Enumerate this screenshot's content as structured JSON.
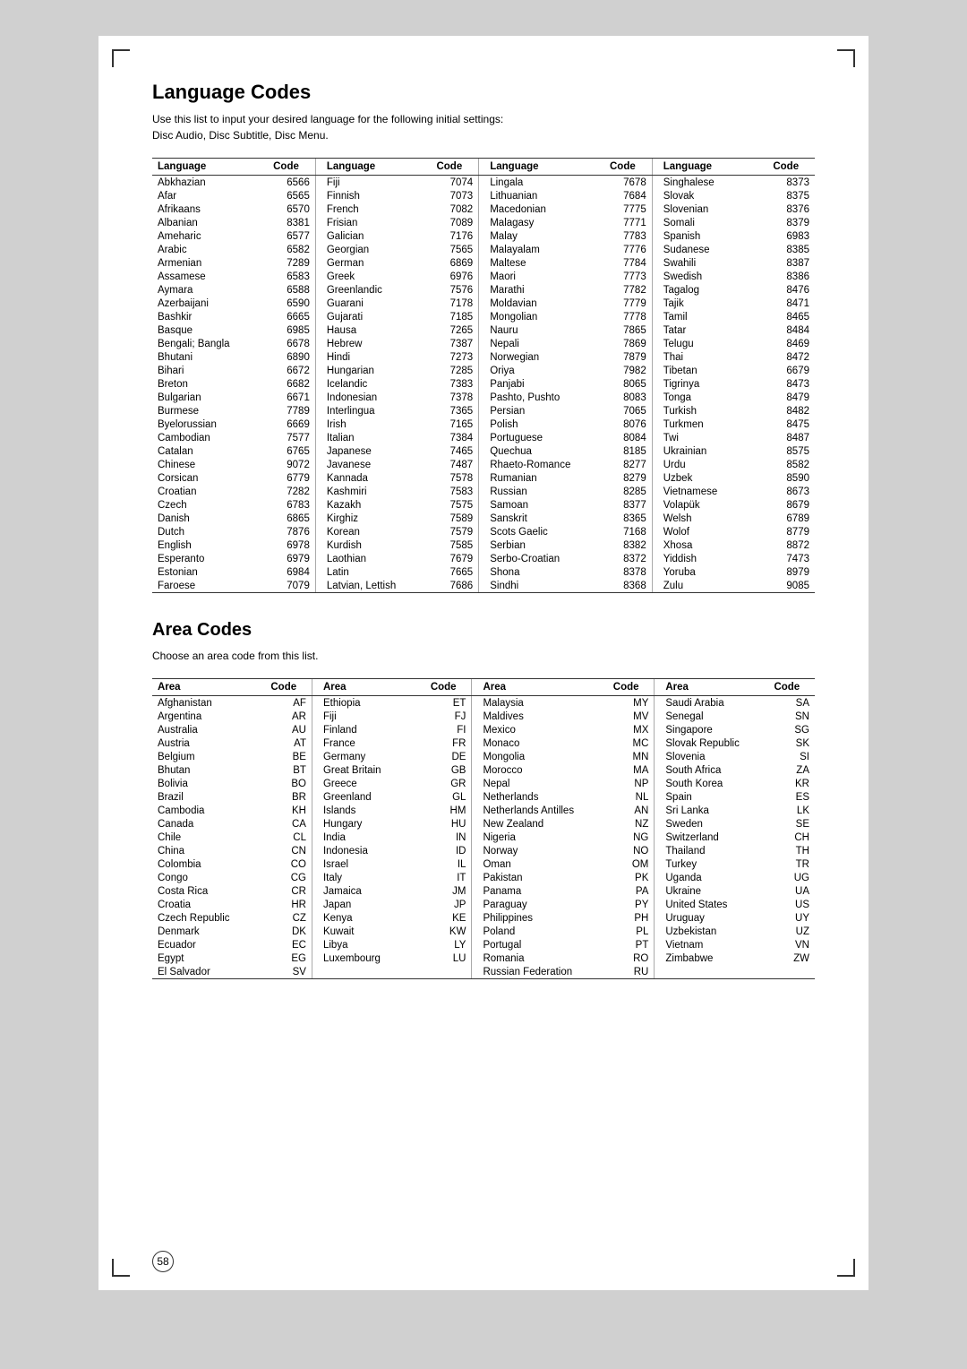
{
  "page": {
    "title": "Language Codes",
    "description": "Use this list to input your desired language for the following initial settings:\nDisc Audio, Disc Subtitle, Disc Menu.",
    "area_title": "Area Codes",
    "area_description": "Choose an area code from this list.",
    "page_number": "58"
  },
  "language_table": {
    "headers": [
      "Language",
      "Code"
    ],
    "columns": [
      [
        [
          "Abkhazian",
          "6566"
        ],
        [
          "Afar",
          "6565"
        ],
        [
          "Afrikaans",
          "6570"
        ],
        [
          "Albanian",
          "8381"
        ],
        [
          "Ameharic",
          "6577"
        ],
        [
          "Arabic",
          "6582"
        ],
        [
          "Armenian",
          "7289"
        ],
        [
          "Assamese",
          "6583"
        ],
        [
          "Aymara",
          "6588"
        ],
        [
          "Azerbaijani",
          "6590"
        ],
        [
          "Bashkir",
          "6665"
        ],
        [
          "Basque",
          "6985"
        ],
        [
          "Bengali; Bangla",
          "6678"
        ],
        [
          "Bhutani",
          "6890"
        ],
        [
          "Bihari",
          "6672"
        ],
        [
          "Breton",
          "6682"
        ],
        [
          "Bulgarian",
          "6671"
        ],
        [
          "Burmese",
          "7789"
        ],
        [
          "Byelorussian",
          "6669"
        ],
        [
          "Cambodian",
          "7577"
        ],
        [
          "Catalan",
          "6765"
        ],
        [
          "Chinese",
          "9072"
        ],
        [
          "Corsican",
          "6779"
        ],
        [
          "Croatian",
          "7282"
        ],
        [
          "Czech",
          "6783"
        ],
        [
          "Danish",
          "6865"
        ],
        [
          "Dutch",
          "7876"
        ],
        [
          "English",
          "6978"
        ],
        [
          "Esperanto",
          "6979"
        ],
        [
          "Estonian",
          "6984"
        ],
        [
          "Faroese",
          "7079"
        ]
      ],
      [
        [
          "Fiji",
          "7074"
        ],
        [
          "Finnish",
          "7073"
        ],
        [
          "French",
          "7082"
        ],
        [
          "Frisian",
          "7089"
        ],
        [
          "Galician",
          "7176"
        ],
        [
          "Georgian",
          "7565"
        ],
        [
          "German",
          "6869"
        ],
        [
          "Greek",
          "6976"
        ],
        [
          "Greenlandic",
          "7576"
        ],
        [
          "Guarani",
          "7178"
        ],
        [
          "Gujarati",
          "7185"
        ],
        [
          "Hausa",
          "7265"
        ],
        [
          "Hebrew",
          "7387"
        ],
        [
          "Hindi",
          "7273"
        ],
        [
          "Hungarian",
          "7285"
        ],
        [
          "Icelandic",
          "7383"
        ],
        [
          "Indonesian",
          "7378"
        ],
        [
          "Interlingua",
          "7365"
        ],
        [
          "Irish",
          "7165"
        ],
        [
          "Italian",
          "7384"
        ],
        [
          "Japanese",
          "7465"
        ],
        [
          "Javanese",
          "7487"
        ],
        [
          "Kannada",
          "7578"
        ],
        [
          "Kashmiri",
          "7583"
        ],
        [
          "Kazakh",
          "7575"
        ],
        [
          "Kirghiz",
          "7589"
        ],
        [
          "Korean",
          "7579"
        ],
        [
          "Kurdish",
          "7585"
        ],
        [
          "Laothian",
          "7679"
        ],
        [
          "Latin",
          "7665"
        ],
        [
          "Latvian, Lettish",
          "7686"
        ]
      ],
      [
        [
          "Lingala",
          "7678"
        ],
        [
          "Lithuanian",
          "7684"
        ],
        [
          "Macedonian",
          "7775"
        ],
        [
          "Malagasy",
          "7771"
        ],
        [
          "Malay",
          "7783"
        ],
        [
          "Malayalam",
          "7776"
        ],
        [
          "Maltese",
          "7784"
        ],
        [
          "Maori",
          "7773"
        ],
        [
          "Marathi",
          "7782"
        ],
        [
          "Moldavian",
          "7779"
        ],
        [
          "Mongolian",
          "7778"
        ],
        [
          "Nauru",
          "7865"
        ],
        [
          "Nepali",
          "7869"
        ],
        [
          "Norwegian",
          "7879"
        ],
        [
          "Oriya",
          "7982"
        ],
        [
          "Panjabi",
          "8065"
        ],
        [
          "Pashto, Pushto",
          "8083"
        ],
        [
          "Persian",
          "7065"
        ],
        [
          "Polish",
          "8076"
        ],
        [
          "Portuguese",
          "8084"
        ],
        [
          "Quechua",
          "8185"
        ],
        [
          "Rhaeto-Romance",
          "8277"
        ],
        [
          "Rumanian",
          "8279"
        ],
        [
          "Russian",
          "8285"
        ],
        [
          "Samoan",
          "8377"
        ],
        [
          "Sanskrit",
          "8365"
        ],
        [
          "Scots Gaelic",
          "7168"
        ],
        [
          "Serbian",
          "8382"
        ],
        [
          "Serbo-Croatian",
          "8372"
        ],
        [
          "Shona",
          "8378"
        ],
        [
          "Sindhi",
          "8368"
        ]
      ],
      [
        [
          "Singhalese",
          "8373"
        ],
        [
          "Slovak",
          "8375"
        ],
        [
          "Slovenian",
          "8376"
        ],
        [
          "Somali",
          "8379"
        ],
        [
          "Spanish",
          "6983"
        ],
        [
          "Sudanese",
          "8385"
        ],
        [
          "Swahili",
          "8387"
        ],
        [
          "Swedish",
          "8386"
        ],
        [
          "Tagalog",
          "8476"
        ],
        [
          "Tajik",
          "8471"
        ],
        [
          "Tamil",
          "8465"
        ],
        [
          "Tatar",
          "8484"
        ],
        [
          "Telugu",
          "8469"
        ],
        [
          "Thai",
          "8472"
        ],
        [
          "Tibetan",
          "6679"
        ],
        [
          "Tigrinya",
          "8473"
        ],
        [
          "Tonga",
          "8479"
        ],
        [
          "Turkish",
          "8482"
        ],
        [
          "Turkmen",
          "8475"
        ],
        [
          "Twi",
          "8487"
        ],
        [
          "Ukrainian",
          "8575"
        ],
        [
          "Urdu",
          "8582"
        ],
        [
          "Uzbek",
          "8590"
        ],
        [
          "Vietnamese",
          "8673"
        ],
        [
          "Volapük",
          "8679"
        ],
        [
          "Welsh",
          "6789"
        ],
        [
          "Wolof",
          "8779"
        ],
        [
          "Xhosa",
          "8872"
        ],
        [
          "Yiddish",
          "7473"
        ],
        [
          "Yoruba",
          "8979"
        ],
        [
          "Zulu",
          "9085"
        ]
      ]
    ]
  },
  "area_table": {
    "headers": [
      "Area",
      "Code"
    ],
    "columns": [
      [
        [
          "Afghanistan",
          "AF"
        ],
        [
          "Argentina",
          "AR"
        ],
        [
          "Australia",
          "AU"
        ],
        [
          "Austria",
          "AT"
        ],
        [
          "Belgium",
          "BE"
        ],
        [
          "Bhutan",
          "BT"
        ],
        [
          "Bolivia",
          "BO"
        ],
        [
          "Brazil",
          "BR"
        ],
        [
          "Cambodia",
          "KH"
        ],
        [
          "Canada",
          "CA"
        ],
        [
          "Chile",
          "CL"
        ],
        [
          "China",
          "CN"
        ],
        [
          "Colombia",
          "CO"
        ],
        [
          "Congo",
          "CG"
        ],
        [
          "Costa Rica",
          "CR"
        ],
        [
          "Croatia",
          "HR"
        ],
        [
          "Czech Republic",
          "CZ"
        ],
        [
          "Denmark",
          "DK"
        ],
        [
          "Ecuador",
          "EC"
        ],
        [
          "Egypt",
          "EG"
        ],
        [
          "El Salvador",
          "SV"
        ]
      ],
      [
        [
          "Ethiopia",
          "ET"
        ],
        [
          "Fiji",
          "FJ"
        ],
        [
          "Finland",
          "FI"
        ],
        [
          "France",
          "FR"
        ],
        [
          "Germany",
          "DE"
        ],
        [
          "Great Britain",
          "GB"
        ],
        [
          "Greece",
          "GR"
        ],
        [
          "Greenland",
          "GL"
        ],
        [
          "Islands",
          "HM"
        ],
        [
          "Hungary",
          "HU"
        ],
        [
          "India",
          "IN"
        ],
        [
          "Indonesia",
          "ID"
        ],
        [
          "Israel",
          "IL"
        ],
        [
          "Italy",
          "IT"
        ],
        [
          "Jamaica",
          "JM"
        ],
        [
          "Japan",
          "JP"
        ],
        [
          "Kenya",
          "KE"
        ],
        [
          "Kuwait",
          "KW"
        ],
        [
          "Libya",
          "LY"
        ],
        [
          "Luxembourg",
          "LU"
        ]
      ],
      [
        [
          "Malaysia",
          "MY"
        ],
        [
          "Maldives",
          "MV"
        ],
        [
          "Mexico",
          "MX"
        ],
        [
          "Monaco",
          "MC"
        ],
        [
          "Mongolia",
          "MN"
        ],
        [
          "Morocco",
          "MA"
        ],
        [
          "Nepal",
          "NP"
        ],
        [
          "Netherlands",
          "NL"
        ],
        [
          "Netherlands Antilles",
          "AN"
        ],
        [
          "New Zealand",
          "NZ"
        ],
        [
          "Nigeria",
          "NG"
        ],
        [
          "Norway",
          "NO"
        ],
        [
          "Oman",
          "OM"
        ],
        [
          "Pakistan",
          "PK"
        ],
        [
          "Panama",
          "PA"
        ],
        [
          "Paraguay",
          "PY"
        ],
        [
          "Philippines",
          "PH"
        ],
        [
          "Poland",
          "PL"
        ],
        [
          "Portugal",
          "PT"
        ],
        [
          "Romania",
          "RO"
        ],
        [
          "Russian Federation",
          "RU"
        ]
      ],
      [
        [
          "Saudi Arabia",
          "SA"
        ],
        [
          "Senegal",
          "SN"
        ],
        [
          "Singapore",
          "SG"
        ],
        [
          "Slovak Republic",
          "SK"
        ],
        [
          "Slovenia",
          "SI"
        ],
        [
          "South Africa",
          "ZA"
        ],
        [
          "South Korea",
          "KR"
        ],
        [
          "Spain",
          "ES"
        ],
        [
          "Sri Lanka",
          "LK"
        ],
        [
          "Sweden",
          "SE"
        ],
        [
          "Switzerland",
          "CH"
        ],
        [
          "Thailand",
          "TH"
        ],
        [
          "Turkey",
          "TR"
        ],
        [
          "Uganda",
          "UG"
        ],
        [
          "Ukraine",
          "UA"
        ],
        [
          "United States",
          "US"
        ],
        [
          "Uruguay",
          "UY"
        ],
        [
          "Uzbekistan",
          "UZ"
        ],
        [
          "Vietnam",
          "VN"
        ],
        [
          "Zimbabwe",
          "ZW"
        ]
      ]
    ]
  }
}
